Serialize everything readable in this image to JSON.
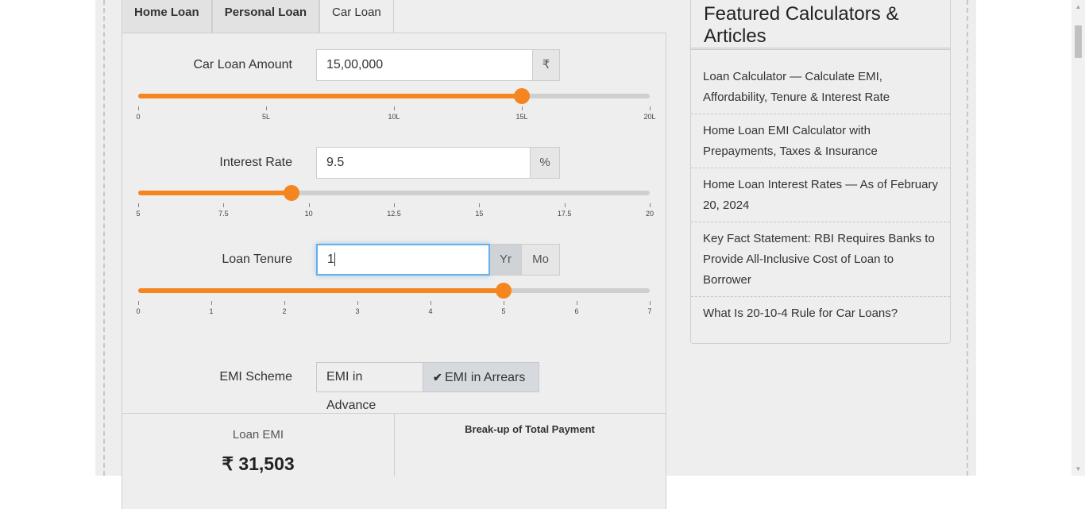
{
  "tabs": [
    {
      "label": "Home Loan",
      "active": false
    },
    {
      "label": "Personal Loan",
      "active": false
    },
    {
      "label": "Car Loan",
      "active": true
    }
  ],
  "loan_amount": {
    "label": "Car Loan Amount",
    "value": "15,00,000",
    "unit": "₹",
    "slider_fraction": 0.75,
    "ticks": [
      "0",
      "5L",
      "10L",
      "15L",
      "20L"
    ]
  },
  "interest_rate": {
    "label": "Interest Rate",
    "value": "9.5",
    "unit": "%",
    "slider_fraction": 0.3,
    "ticks": [
      "5",
      "7.5",
      "10",
      "12.5",
      "15",
      "17.5",
      "20"
    ]
  },
  "loan_tenure": {
    "label": "Loan Tenure",
    "value": "1",
    "unit_year": "Yr",
    "unit_month": "Mo",
    "selected_unit": "Yr",
    "slider_fraction": 0.714,
    "ticks": [
      "0",
      "1",
      "2",
      "3",
      "4",
      "5",
      "6",
      "7"
    ]
  },
  "emi_scheme": {
    "label": "EMI Scheme",
    "advance_label": "EMI in Advance",
    "arrears_label": "EMI in Arrears",
    "selected": "arrears"
  },
  "result": {
    "emi_label": "Loan EMI",
    "emi_value": "₹ 31,503",
    "breakup_title": "Break-up of Total Payment"
  },
  "sidebar": {
    "title": "Featured Calculators & Articles",
    "articles": [
      "Loan Calculator — Calculate EMI, Affordability, Tenure & Interest Rate",
      "Home Loan EMI Calculator with Prepayments, Taxes & Insurance",
      "Home Loan Interest Rates — As of February 20, 2024",
      "Key Fact Statement: RBI Requires Banks to Provide All-Inclusive Cost of Loan to Borrower",
      "What Is 20-10-4 Rule for Car Loans?"
    ]
  },
  "colors": {
    "accent": "#f5861f",
    "track": "#cfcfcf",
    "background": "#eeeeee",
    "focus": "#66afe9"
  }
}
